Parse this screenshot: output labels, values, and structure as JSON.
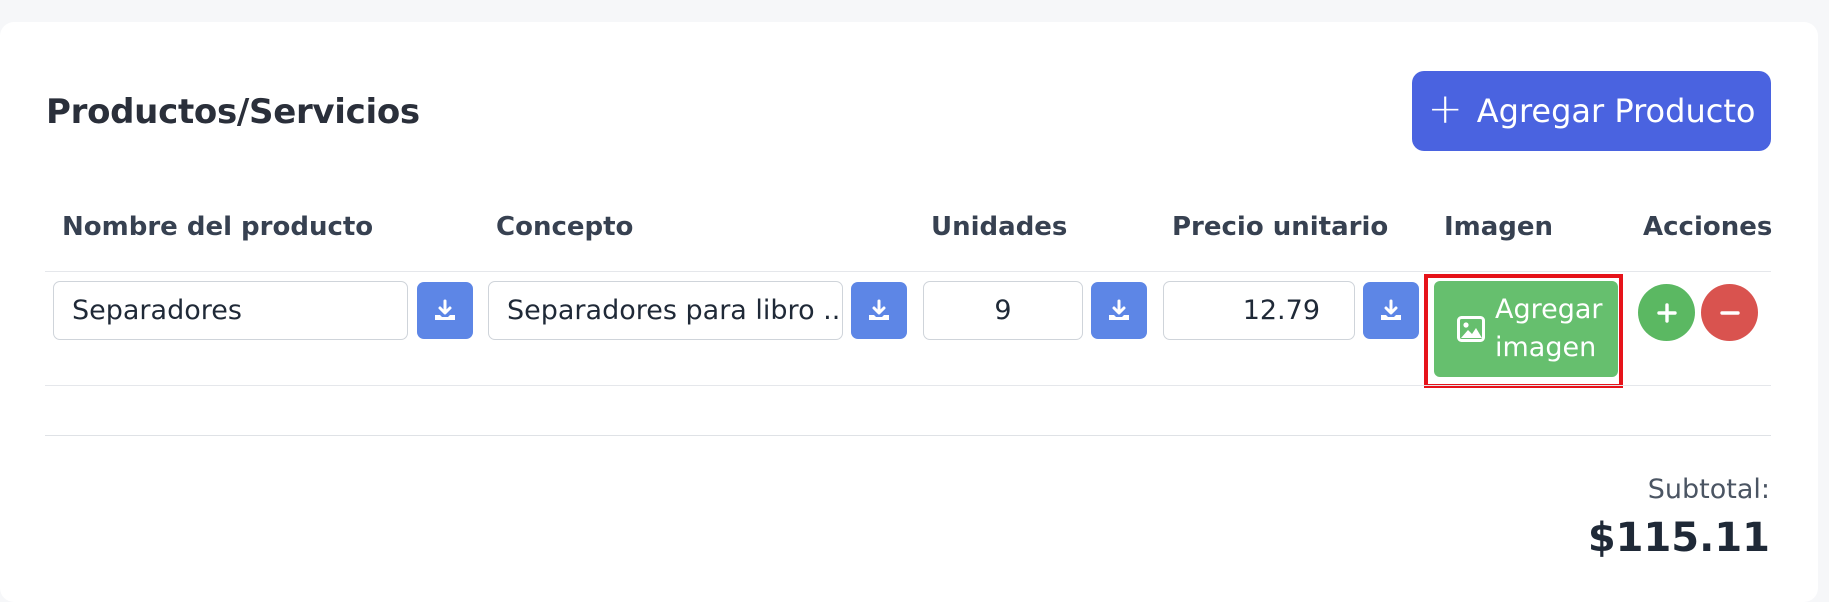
{
  "section": {
    "title": "Productos/Servicios",
    "add_product_label": "Agregar Producto"
  },
  "table": {
    "columns": [
      "Nombre del producto",
      "Concepto",
      "Unidades",
      "Precio unitario",
      "Imagen",
      "Acciones"
    ],
    "rows": [
      {
        "product_name": "Separadores",
        "concept": "Separadores para libro ...",
        "units": "9",
        "unit_price": "12.79",
        "image_button_label_1": "Agregar",
        "image_button_label_2": "imagen"
      }
    ]
  },
  "totals": {
    "subtotal_label": "Subtotal:",
    "subtotal_value": "$115.11"
  },
  "icons": {
    "add_product": "plus-icon",
    "download": "download-icon",
    "image": "image-icon",
    "add_row": "plus-icon",
    "remove_row": "minus-icon"
  },
  "colors": {
    "primary": "#4a63e0",
    "download_button": "#5d86e6",
    "image_button": "#66bf6e",
    "add_row": "#5bb862",
    "remove_row": "#d9534f",
    "highlight": "#e6131a"
  }
}
